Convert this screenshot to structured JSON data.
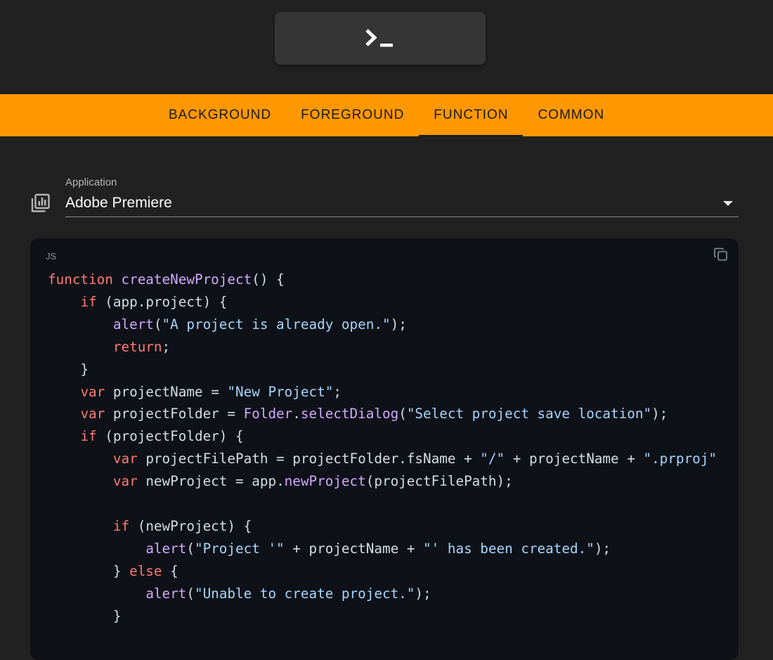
{
  "header": {
    "terminal_icon": "terminal-prompt-icon"
  },
  "tabs": [
    {
      "label": "BACKGROUND",
      "active": false
    },
    {
      "label": "FOREGROUND",
      "active": false
    },
    {
      "label": "FUNCTION",
      "active": true
    },
    {
      "label": "COMMON",
      "active": false
    }
  ],
  "application": {
    "label": "Application",
    "value": "Adobe Premiere",
    "icon": "library-chart-icon"
  },
  "code": {
    "language": "JS",
    "copy_icon": "copy-icon",
    "lines": [
      "function createNewProject() {",
      "    if (app.project) {",
      "        alert(\"A project is already open.\");",
      "        return;",
      "    }",
      "    var projectName = \"New Project\";",
      "    var projectFolder = Folder.selectDialog(\"Select project save location\");",
      "    if (projectFolder) {",
      "        var projectFilePath = projectFolder.fsName + \"/\" + projectName + \".prproj\"",
      "        var newProject = app.newProject(projectFilePath);",
      "",
      "        if (newProject) {",
      "            alert(\"Project '\" + projectName + \"' has been created.\");",
      "        } else {",
      "            alert(\"Unable to create project.\");",
      "        }"
    ]
  },
  "colors": {
    "tab_bar": "#ff9800",
    "background": "#212121",
    "code_background": "#0e1117",
    "keyword": "#ff7b72",
    "function": "#d2a8ff",
    "string": "#a5d6ff"
  }
}
